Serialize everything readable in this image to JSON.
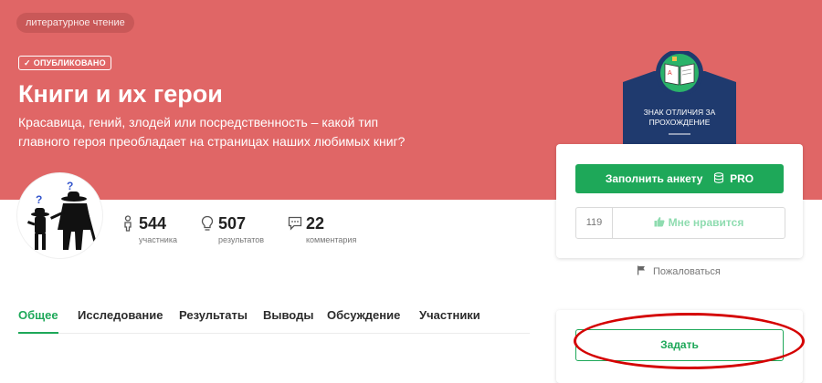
{
  "hero": {
    "tag": "литературное чтение",
    "status": "ОПУБЛИКОВАНО",
    "title": "Книги и их герои",
    "subtitle": "Красавица, гений, злодей или посредственность – какой тип главного героя преобладает на страницах наших любимых книг?"
  },
  "stats": [
    {
      "value": "544",
      "label": "участника",
      "icon": "person-icon"
    },
    {
      "value": "507",
      "label": "результатов",
      "icon": "lightbulb-icon"
    },
    {
      "value": "22",
      "label": "комментария",
      "icon": "comment-icon"
    }
  ],
  "tabs": [
    "Общее",
    "Исследование",
    "Результаты",
    "Выводы",
    "Обсуждение",
    "Участники"
  ],
  "badge": {
    "line1": "ЗНАК ОТЛИЧИЯ ЗА",
    "line2": "ПРОХОЖДЕНИЕ"
  },
  "sidebar": {
    "fill_label": "Заполнить анкету",
    "pro_label": "PRO",
    "like_count": "119",
    "like_label": "Мне нравится",
    "report_label": "Пожаловаться",
    "ask_label": "Задать"
  },
  "colors": {
    "hero": "#e06666",
    "accent": "#1ea859",
    "badge": "#1f3a6e",
    "annotation": "#d40000"
  }
}
